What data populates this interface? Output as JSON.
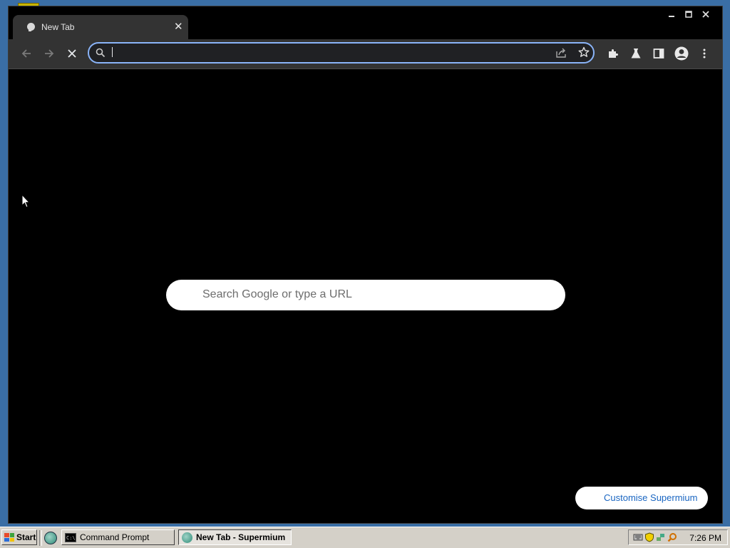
{
  "browser": {
    "tab": {
      "title": "New Tab"
    },
    "omnibox": {
      "value": ""
    },
    "new_tab_page": {
      "search_placeholder": "Search Google or type a URL",
      "customise_label": "Customise Supermium"
    }
  },
  "taskbar": {
    "start_label": "Start",
    "tasks": [
      {
        "label": "Command Prompt",
        "active": false
      },
      {
        "label": "New Tab - Supermium",
        "active": true
      }
    ],
    "clock": "7:26 PM"
  },
  "colors": {
    "window_bg": "#000000",
    "toolbar_bg": "#333333",
    "focus_ring": "#8ab4f8",
    "customise_text": "#1a66c2",
    "desktop": "#3a6ea5"
  }
}
